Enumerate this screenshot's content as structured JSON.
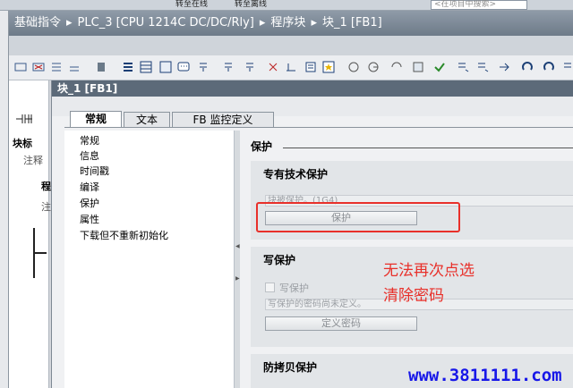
{
  "top_toolbar": {
    "go_online": "转至在线",
    "go_offline": "转至离线",
    "search_placeholder": "<在项目中搜索>"
  },
  "breadcrumb": [
    "基础指令",
    "PLC_3 [CPU 1214C DC/DC/Rly]",
    "程序块",
    "块_1 [FB1]"
  ],
  "left_pane": {
    "row1": "块标",
    "row2": "注释",
    "row3": "程",
    "row4": "注"
  },
  "dialog": {
    "title": "块_1 [FB1]",
    "tabs": [
      {
        "label": "常规",
        "active": true
      },
      {
        "label": "文本",
        "active": false
      },
      {
        "label": "FB 监控定义",
        "active": false
      }
    ],
    "nav_items": [
      "常规",
      "信息",
      "时间戳",
      "编译",
      "保护",
      "属性",
      "下载但不重新初始化"
    ],
    "section_title": "保护",
    "know_how": {
      "title": "专有技术保护",
      "field_text": "块被保护。(1G4)",
      "button": "保护"
    },
    "write_protect": {
      "title": "写保护",
      "checkbox_label": "写保护",
      "field_text": "写保护的密码尚未定义。",
      "button": "定义密码"
    },
    "copy_protect": {
      "title": "防拷贝保护"
    }
  },
  "annotation": {
    "line1": "无法再次点选",
    "line2": "清除密码",
    "color": "#e8302a"
  },
  "watermark": "www.3811111.com"
}
